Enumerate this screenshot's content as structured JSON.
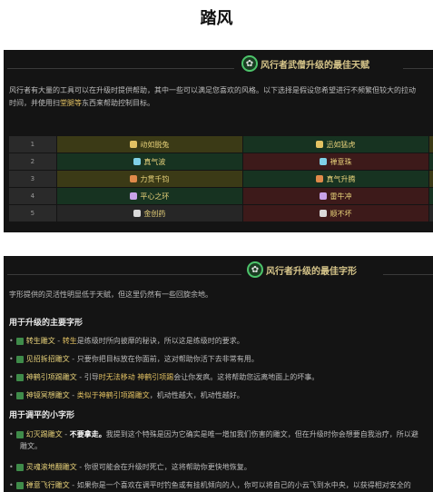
{
  "page_title": "踏风",
  "section1": {
    "title": "风行者武僧升级的最佳天赋",
    "intro_line1": "风行者有大量的工具可以在升级时提供帮助，其中一些可以满足您喜欢的风格。以下选择是假设您希望进行不频繁但较大的拉动",
    "intro_line2_a": "时间，并使用扫",
    "intro_line2_hl": "堂腿等",
    "intro_line2_b": "东西来帮助控制目标。",
    "table": [
      {
        "num": "1",
        "left": "动如脱兔",
        "right": "迅如猛虎",
        "left_color": "olive",
        "right_color": "green"
      },
      {
        "num": "2",
        "left": "真气波",
        "right": "禅意珠",
        "left_color": "green",
        "right_color": "red"
      },
      {
        "num": "3",
        "left": "力贯千钧",
        "right": "真气升腾",
        "left_color": "olive",
        "right_color": "green"
      },
      {
        "num": "4",
        "left": "平心之环",
        "right": "雷牛冲",
        "left_color": "green",
        "right_color": "red"
      },
      {
        "num": "5",
        "left": "金创药",
        "right": "顺不坏",
        "left_color": "dark",
        "right_color": "red"
      }
    ]
  },
  "section2": {
    "title": "风行者升级的最佳字形",
    "intro": "字形提供的灵活性明显低于天赋，但这里仍然有一些回旋余地。",
    "major_heading": "用于升级的主要字形",
    "major": [
      {
        "name": "转生雕文",
        "sep": " - ",
        "pre": "",
        "hl": "转生",
        "rest": "是练级时所向披靡的秘诀，所以这是练级时的要求。"
      },
      {
        "name": "见招拆招雕文",
        "sep": " - ",
        "pre": "",
        "hl": "",
        "rest": "只要你把目标放在你面前，这对帮助你活下去非常有用。"
      },
      {
        "name": "神鹤引项踢雕文",
        "sep": " - ",
        "pre": "引导",
        "hl": "时无法移动 神鹤引项踢",
        "rest": "会让你发疯。这将帮助您远离地面上的坏事。"
      },
      {
        "name": "神镜冥想雕文",
        "sep": " - ",
        "pre": "",
        "hl": "类似于神鹤引项踢雕文",
        "rest": "，机动性越大，机动性越好。"
      }
    ],
    "minor_heading": "用于调平的小字形",
    "minor": [
      {
        "name": "幻灭踢雕文",
        "sep": " - ",
        "strong": "不要拿走。",
        "rest": "我提到这个特殊是因为它确实是唯一增加我们伤害的雕文，但在升级时你会想要自我治疗，所以避",
        "wrap": "雕文。"
      },
      {
        "name": "灵魂滚地翻雕文",
        "sep": " - ",
        "strong": "",
        "rest": "你很可能会在升级时死亡，这将帮助你更快地恢复。",
        "wrap": ""
      },
      {
        "name": "禅意飞行雕文",
        "sep": " - ",
        "strong": "",
        "rest": "如果你是一个喜欢在调平时钓鱼或有挂机倾向的人，你可以将自己的小云飞到水中央，以获得相对安全的",
        "wrap": ""
      }
    ]
  }
}
